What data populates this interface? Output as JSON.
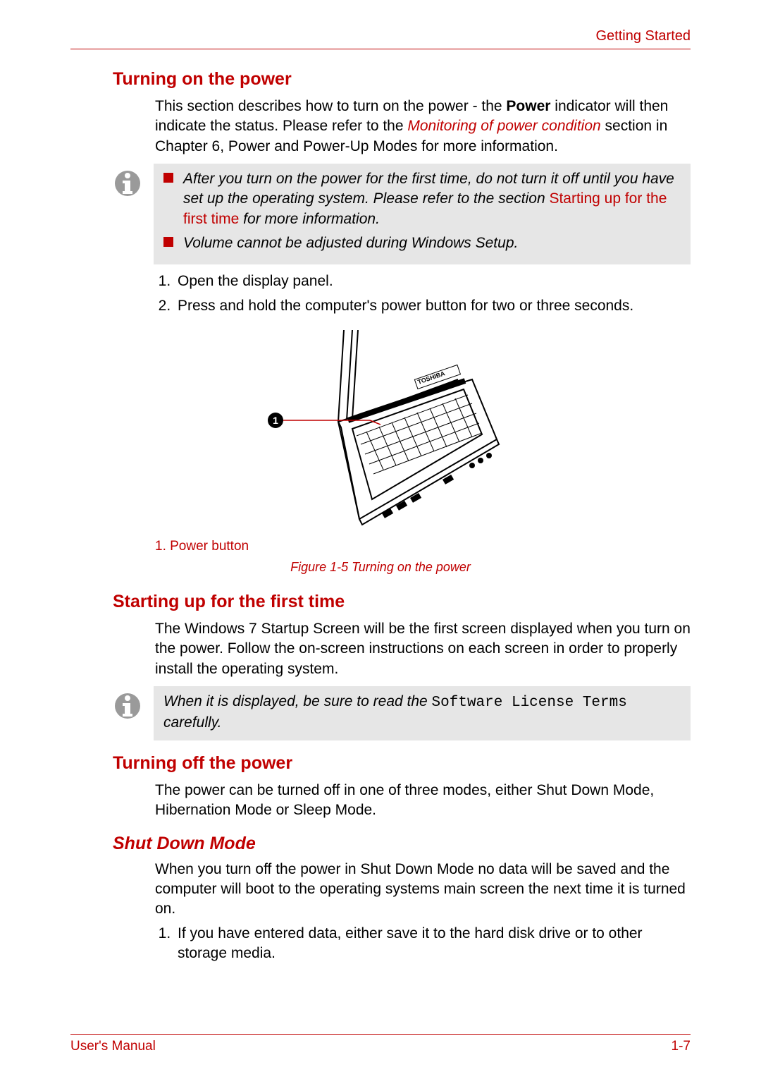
{
  "header": {
    "right": "Getting Started"
  },
  "s1": {
    "heading": "Turning on the power",
    "intro_a": "This section describes how to turn on the power - the ",
    "intro_bold": "Power",
    "intro_b": " indicator will then indicate the status. Please refer to the ",
    "intro_link": "Monitoring of power condition",
    "intro_c": " section in Chapter 6, Power and Power-Up Modes for more information.",
    "note1_a": "After you turn on the power for the first time, do not turn it off until you have set up the operating system. Please refer to the section ",
    "note1_link": "Starting up for the first time",
    "note1_b": " for more information.",
    "note2": "Volume cannot be adjusted during Windows Setup.",
    "steps": [
      "Open the display panel.",
      "Press and hold the computer's power button for two or three seconds."
    ],
    "figure_brand": "TOSHIBA",
    "callout_num": "1",
    "figure_label": "1. Power button",
    "figure_caption": "Figure 1-5 Turning on the power"
  },
  "s2": {
    "heading": "Starting up for the first time",
    "body": "The Windows 7 Startup Screen will be the first screen displayed when you turn on the power. Follow the on-screen instructions on each screen in order to properly install the operating system.",
    "note_a": "When it is displayed, be sure to read the ",
    "note_mono": "Software License Terms",
    "note_b": " carefully."
  },
  "s3": {
    "heading": "Turning off the power",
    "body": "The power can be turned off in one of three modes, either Shut Down Mode, Hibernation Mode or Sleep Mode."
  },
  "s4": {
    "heading": "Shut Down Mode",
    "body": "When you turn off the power in Shut Down Mode no data will be saved and the computer will boot to the operating systems main screen the next time it is turned on.",
    "steps": [
      "If you have entered data, either save it to the hard disk drive or to other storage media."
    ]
  },
  "footer": {
    "left": "User's Manual",
    "right": "1-7"
  }
}
